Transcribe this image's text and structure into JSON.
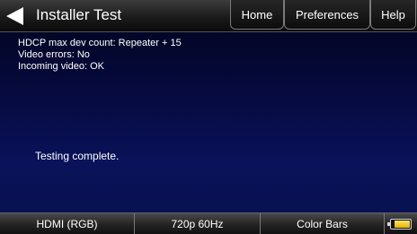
{
  "header": {
    "title": "Installer Test",
    "tabs": {
      "home": "Home",
      "preferences": "Preferences",
      "help": "Help"
    }
  },
  "status": {
    "hdcp": "HDCP max dev count: Repeater + 15",
    "video_errors": "Video errors: No",
    "incoming_video": "Incoming video: OK"
  },
  "message": "Testing complete.",
  "footer": {
    "format": "HDMI (RGB)",
    "timing": "720p 60Hz",
    "pattern": "Color Bars",
    "battery_level": 0.85
  },
  "icons": {
    "back": "back-arrow-icon",
    "battery": "battery-icon"
  },
  "colors": {
    "accent": "#ffffff",
    "battery": "#e8c000",
    "background": "#07104c"
  }
}
